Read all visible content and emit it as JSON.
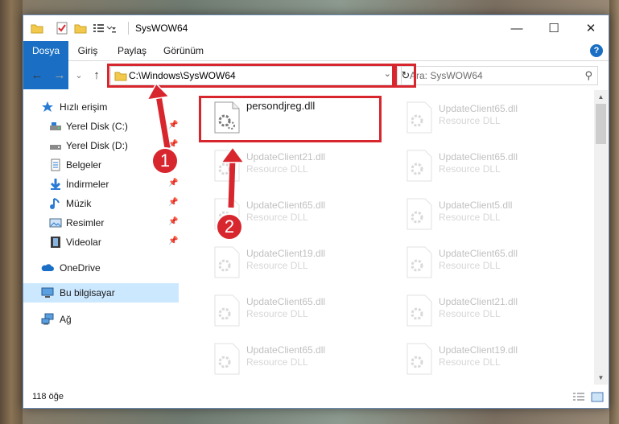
{
  "window": {
    "title": "SysWOW64",
    "controls": {
      "minimize": "—",
      "maximize": "☐",
      "close": "✕"
    }
  },
  "ribbon": {
    "tabs": [
      {
        "label": "Dosya"
      },
      {
        "label": "Giriş"
      },
      {
        "label": "Paylaş"
      },
      {
        "label": "Görünüm"
      }
    ],
    "help": "?"
  },
  "navigation": {
    "back": "←",
    "forward": "→",
    "recent": "⌄",
    "up": "↑",
    "address": "C:\\Windows\\SysWOW64",
    "address_dropdown": "⌄",
    "refresh": "↻",
    "search_placeholder": "Ara: SysWOW64",
    "search_icon": "⚲"
  },
  "sidebar": {
    "items": [
      {
        "label": "Hızlı erişim",
        "icon": "star-icon",
        "pinned": false
      },
      {
        "label": "Yerel Disk (C:)",
        "icon": "drive-icon",
        "pinned": true
      },
      {
        "label": "Yerel Disk (D:)",
        "icon": "drive-icon",
        "pinned": true
      },
      {
        "label": "Belgeler",
        "icon": "documents-icon",
        "pinned": false
      },
      {
        "label": "İndirmeler",
        "icon": "download-icon",
        "pinned": true
      },
      {
        "label": "Müzik",
        "icon": "music-icon",
        "pinned": true
      },
      {
        "label": "Resimler",
        "icon": "pictures-icon",
        "pinned": true
      },
      {
        "label": "Videolar",
        "icon": "videos-icon",
        "pinned": true
      },
      {
        "label": "OneDrive",
        "icon": "cloud-icon",
        "pinned": false
      },
      {
        "label": "Bu bilgisayar",
        "icon": "computer-icon",
        "pinned": false,
        "selected": true
      },
      {
        "label": "Ağ",
        "icon": "network-icon",
        "pinned": false
      }
    ],
    "pin_glyph": "📌"
  },
  "files": [
    {
      "name": "persondjreg.dll",
      "type": ""
    },
    {
      "name": "UpdateClient65.dll",
      "type": "Resource DLL"
    },
    {
      "name": "UpdateClient21.dll",
      "type": "Resource DLL"
    },
    {
      "name": "UpdateClient65.dll",
      "type": "Resource DLL"
    },
    {
      "name": "UpdateClient65.dll",
      "type": "Resource DLL"
    },
    {
      "name": "UpdateClient5.dll",
      "type": "Resource DLL"
    },
    {
      "name": "UpdateClient19.dll",
      "type": "Resource DLL"
    },
    {
      "name": "UpdateClient65.dll",
      "type": "Resource DLL"
    },
    {
      "name": "UpdateClient65.dll",
      "type": "Resource DLL"
    },
    {
      "name": "UpdateClient21.dll",
      "type": "Resource DLL"
    },
    {
      "name": "UpdateClient65.dll",
      "type": "Resource DLL"
    },
    {
      "name": "UpdateClient19.dll",
      "type": "Resource DLL"
    }
  ],
  "status": {
    "item_count": "118 öğe"
  },
  "annotations": [
    {
      "label": "1",
      "color": "#d8262e"
    },
    {
      "label": "2",
      "color": "#d8262e"
    }
  ],
  "colors": {
    "accent": "#1a6fc4",
    "highlight": "#d8262e",
    "selected": "#cce8ff"
  }
}
